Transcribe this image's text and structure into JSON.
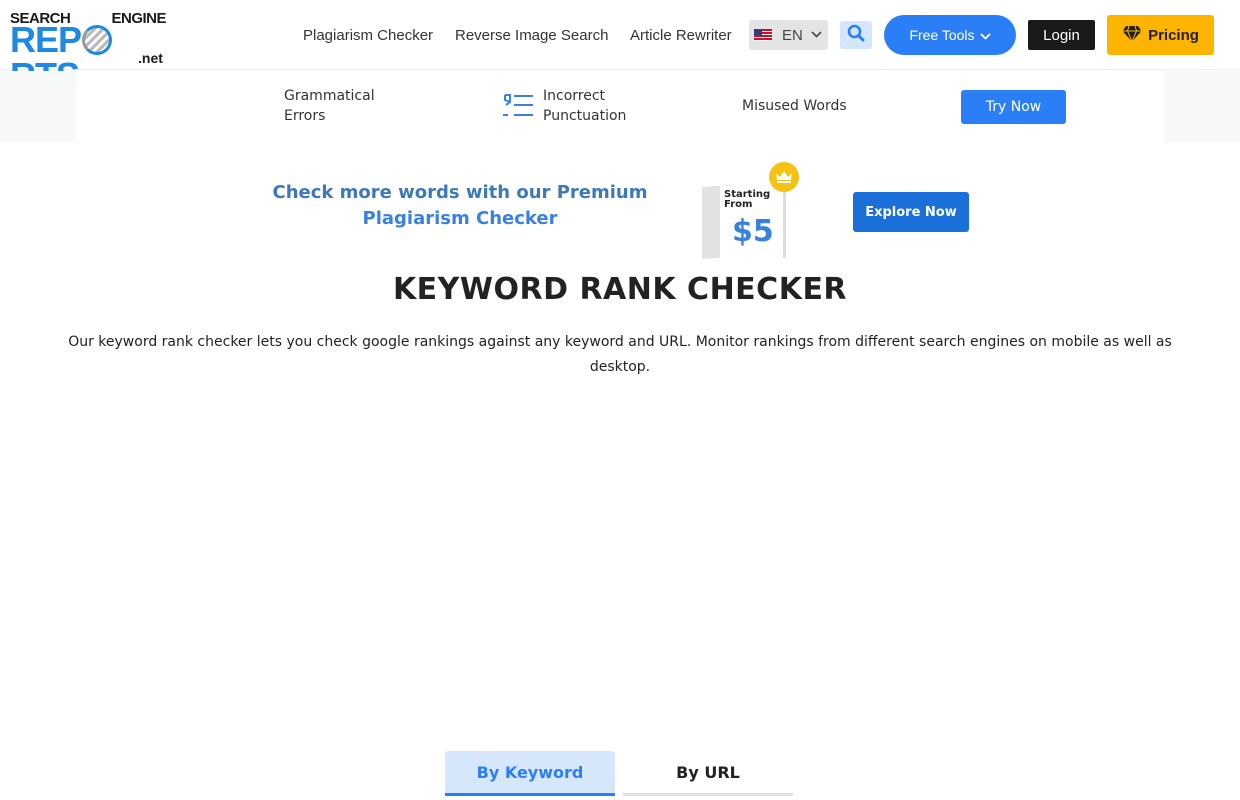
{
  "header": {
    "logo": {
      "top_left": "SEARCH",
      "top_right": "ENGINE",
      "main_left": "REP",
      "main_right": "RTS",
      "suffix": ".net"
    },
    "nav": [
      {
        "label": "Plagiarism Checker"
      },
      {
        "label": "Reverse Image Search"
      },
      {
        "label": "Article Rewriter"
      }
    ],
    "language": {
      "code": "EN",
      "flag": "us-flag-icon"
    },
    "search_icon": "search-icon",
    "free_tools_label": "Free Tools",
    "login_label": "Login",
    "pricing_label": "Pricing"
  },
  "feature_strip": {
    "items": [
      {
        "line1": "Grammatical",
        "line2": "Errors"
      },
      {
        "line1": "Incorrect",
        "line2": "Punctuation",
        "icon": "punctuation-list-icon"
      },
      {
        "line1": "Misused Words"
      }
    ],
    "cta_label": "Try Now"
  },
  "promo": {
    "line1": "Check more words with our Premium",
    "line2": "Plagiarism Checker",
    "badge_text": "Starting From",
    "badge_line1": "Starting",
    "badge_line2": "From",
    "price": "$5",
    "cta_label": "Explore Now",
    "icon": "crown-icon"
  },
  "main": {
    "title": "KEYWORD RANK CHECKER",
    "description": "Our keyword rank checker lets you check google rankings against any keyword and URL. Monitor rankings from different search engines on mobile as well as desktop."
  },
  "tabs": [
    {
      "label": "By Keyword",
      "active": true
    },
    {
      "label": "By URL",
      "active": false
    }
  ],
  "colors": {
    "brand_blue": "#2b7ff6",
    "pricing_yellow": "#ffb400",
    "login_black": "#1a1a1a",
    "promo_blue": "#3d78b8"
  }
}
